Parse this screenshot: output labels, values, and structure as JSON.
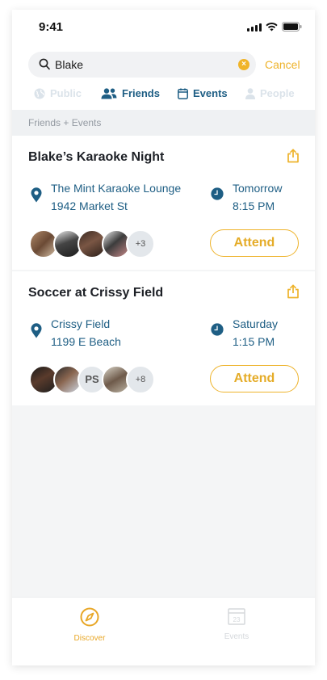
{
  "status": {
    "time": "9:41"
  },
  "search": {
    "value": "Blake",
    "cancel_label": "Cancel"
  },
  "filters": [
    {
      "label": "Public",
      "icon": "globe-icon",
      "active": false
    },
    {
      "label": "Friends",
      "icon": "users-icon",
      "active": true
    },
    {
      "label": "Events",
      "icon": "calendar-icon",
      "active": true
    },
    {
      "label": "People",
      "icon": "person-icon",
      "active": false
    }
  ],
  "section_header": "Friends + Events",
  "events": [
    {
      "title": "Blake’s Karaoke Night",
      "venue": "The Mint Karaoke Lounge",
      "address": "1942 Market St",
      "day": "Tomorrow",
      "time": "8:15 PM",
      "attendees": [
        "photo",
        "photo",
        "photo",
        "photo"
      ],
      "more": "+3",
      "attend_label": "Attend"
    },
    {
      "title": "Soccer at Crissy Field",
      "venue": "Crissy Field",
      "address": "1199 E Beach",
      "day": "Saturday",
      "time": "1:15 PM",
      "attendees": [
        "photo",
        "photo",
        "PS",
        "photo"
      ],
      "initials": "PS",
      "more": "+8",
      "attend_label": "Attend"
    }
  ],
  "tabs": [
    {
      "label": "Discover",
      "icon": "compass-icon",
      "active": true
    },
    {
      "label": "Events",
      "icon": "calendar-icon",
      "active": false,
      "date": "23"
    }
  ],
  "colors": {
    "accent": "#eeb32b",
    "primary": "#1e5e84",
    "inactive": "#dbe3ea"
  }
}
